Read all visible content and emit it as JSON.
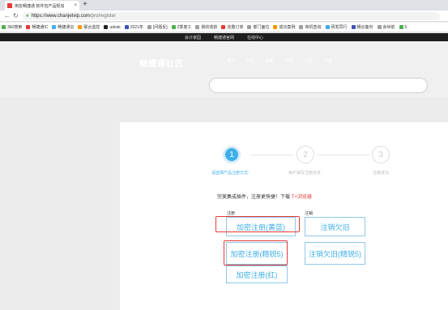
{
  "browser": {
    "tab_title": "用友畅捷通 软件包产品矩加",
    "tab_close": "×",
    "new_tab": "+",
    "url_host": "https://www.chanjetvip.com",
    "url_path": "/pro/register",
    "bookmarks": [
      {
        "label": "360搜索",
        "color": "#4caf50"
      },
      {
        "label": "畅捷通IC",
        "color": "#e53935"
      },
      {
        "label": "畅捷通云",
        "color": "#3daee9"
      },
      {
        "label": "联合监控",
        "color": "#ff9800"
      },
      {
        "label": "udesk",
        "color": "#222222"
      },
      {
        "label": "2021年",
        "color": "#3f51b5"
      },
      {
        "label": "[问题反]",
        "color": "#9e9e9e"
      },
      {
        "label": "2季度工",
        "color": "#4caf50"
      },
      {
        "label": "我的收获",
        "color": "#9e9e9e"
      },
      {
        "label": "完整订单",
        "color": "#e53935"
      },
      {
        "label": "部门面位",
        "color": "#9e9e9e"
      },
      {
        "label": "成功案例",
        "color": "#ff9800"
      },
      {
        "label": "商机查询",
        "color": "#9e9e9e"
      },
      {
        "label": "研发同行",
        "color": "#3daee9"
      },
      {
        "label": "畅云备份",
        "color": "#3f51b5"
      },
      {
        "label": "余世前",
        "color": "#9e9e9e"
      },
      {
        "label": "5",
        "color": "#4caf50"
      }
    ]
  },
  "site": {
    "top_links": [
      "会计家园",
      "畅捷通官网",
      "在线中心"
    ],
    "logo": "畅捷通社区",
    "hero_nav": [
      "首页",
      "产品",
      "服务",
      "学习",
      "社区",
      "下载"
    ]
  },
  "steps": [
    {
      "number": "1",
      "label": "请选择产品注册方式："
    },
    {
      "number": "2",
      "label": "用户填写注册信息"
    },
    {
      "number": "3",
      "label": "注册成功"
    }
  ],
  "notice": {
    "text": "完美集成插件，注册更快捷！下载",
    "link": "T+浏览器"
  },
  "register": {
    "label": "注册",
    "buttons": [
      "加密注册(黄蓝)",
      "加密注册(精锐5)",
      "加密注册(红)"
    ]
  },
  "cancel": {
    "label": "注销",
    "buttons": [
      "注销欠旧",
      "注销欠旧(精锐5)"
    ]
  },
  "colors": {
    "accent": "#3daee9",
    "highlight": "#e53935"
  }
}
